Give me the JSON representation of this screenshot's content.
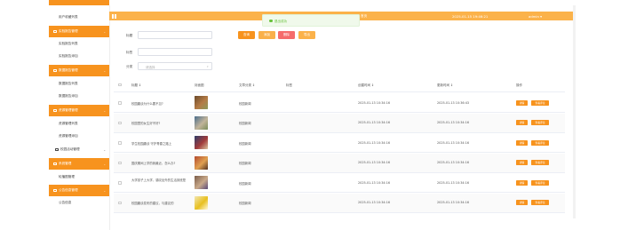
{
  "header": {
    "center_text": "首页",
    "datetime": "2025-01-15 19:46:21",
    "user": "admin ▾"
  },
  "toast": {
    "message": "退出成功"
  },
  "sidebar": {
    "items": [
      {
        "kind": "sub",
        "label": "用户收藏列表"
      },
      {
        "kind": "head",
        "label": "实验报告管理"
      },
      {
        "kind": "sub",
        "label": "实验报告列表"
      },
      {
        "kind": "sub",
        "label": "实验报告添加"
      },
      {
        "kind": "head",
        "label": "数据报告管理"
      },
      {
        "kind": "sub",
        "label": "数据报告列表"
      },
      {
        "kind": "sub",
        "label": "数据报告添加"
      },
      {
        "kind": "head",
        "label": "资源管理管理"
      },
      {
        "kind": "sub",
        "label": "资源管理列表"
      },
      {
        "kind": "sub",
        "label": "资源管理添加"
      },
      {
        "kind": "plain",
        "label": "校园活动管理"
      },
      {
        "kind": "head",
        "label": "系统管理"
      },
      {
        "kind": "sub",
        "label": "轮播图管理"
      },
      {
        "kind": "head",
        "label": "公告信息管理"
      },
      {
        "kind": "sub",
        "label": "公告信息"
      }
    ]
  },
  "filters": {
    "title_label": "标题",
    "tag_label": "标签",
    "category_label": "分类",
    "category_placeholder": "请选择",
    "buttons": [
      {
        "label": "查询",
        "color": "#f7931e"
      },
      {
        "label": "添加",
        "color": "#f9b04a"
      },
      {
        "label": "删除",
        "color": "#f56c6c"
      },
      {
        "label": "导出",
        "color": "#fbb24a"
      }
    ]
  },
  "table": {
    "headers": [
      "标题 ↕",
      "封面图",
      "文章分类 ↕",
      "标签",
      "创建时间 ↕",
      "更新时间 ↕",
      "操作"
    ],
    "rows": [
      {
        "title": "校园趣谈为什么要不见?",
        "category": "校园新闻",
        "tag": "",
        "created": "2025-01-13 10:34:16",
        "updated": "2025-01-13 10:36:43",
        "thumb": [
          "#6b4a2b",
          "#b57b46",
          "#8a9a5b"
        ]
      },
      {
        "title": "校园里的女生好不好?",
        "category": "校园新闻",
        "tag": "",
        "created": "2025-01-13 10:34:16",
        "updated": "2025-01-13 10:34:16",
        "thumb": [
          "#4a6d8c",
          "#c2b49a",
          "#7a8d5a"
        ]
      },
      {
        "title": "学生校园趣谈 守护青春之路上",
        "category": "校园新闻",
        "tag": "",
        "created": "2025-01-13 10:34:16",
        "updated": "2025-01-13 10:34:16",
        "thumb": [
          "#2c3e6b",
          "#a23b3b",
          "#d9c5a0"
        ]
      },
      {
        "title": "国庆期间上学的我最近，怎么办?",
        "category": "校园新闻",
        "tag": "",
        "created": "2025-01-13 10:34:16",
        "updated": "2025-01-13 10:34:16",
        "thumb": [
          "#b34a2f",
          "#e0a050",
          "#553322"
        ]
      },
      {
        "title": "大学孩子上大学，感叹出外的生活到底是",
        "category": "校园新闻",
        "tag": "",
        "created": "2025-01-13 10:34:16",
        "updated": "2025-01-13 10:34:16",
        "thumb": [
          "#7a5c4a",
          "#c9a98a",
          "#5a4a7a"
        ]
      },
      {
        "title": "校园趣谈发布的建议，与建议的",
        "category": "校园新闻",
        "tag": "",
        "created": "2025-01-13 10:34:16",
        "updated": "2025-01-13 10:34:16",
        "thumb": [
          "#f2e6b0",
          "#e8c020",
          "#fff8d8"
        ]
      }
    ],
    "action_detail": "详情",
    "action_comment": "查看评论"
  },
  "colors": {
    "accent": "#f7931e",
    "header": "#fbb24a",
    "success": "#67c23a"
  }
}
